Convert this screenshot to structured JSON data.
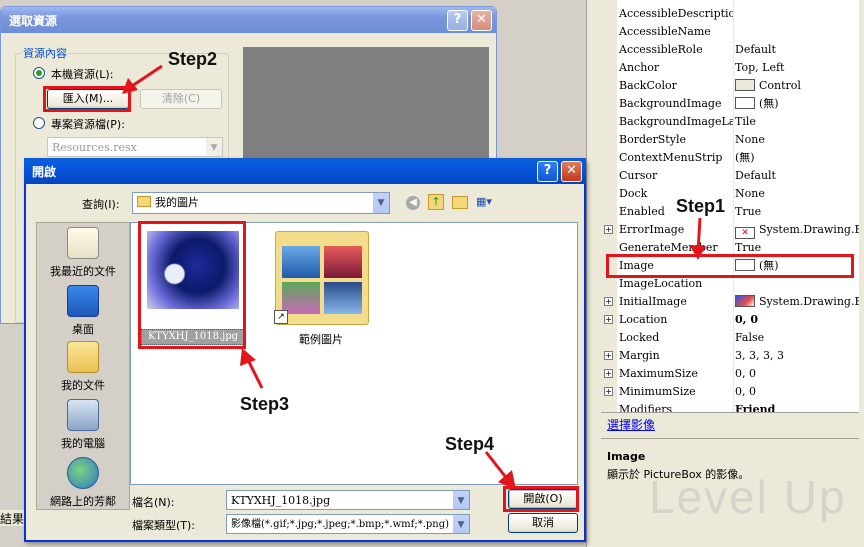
{
  "resource_dialog": {
    "title": "選取資源",
    "group_label": "資源內容",
    "local_radio": "本機資源(L):",
    "import_btn": "匯入(M)...",
    "clear_btn": "清除(C)",
    "project_radio": "專案資源檔(P):",
    "project_combo": "Resources.resx"
  },
  "open_dialog": {
    "title": "開啟",
    "lookin_label": "查詢(I):",
    "lookin_value": "我的圖片",
    "places": [
      "我最近的文件",
      "桌面",
      "我的文件",
      "我的電腦",
      "網路上的芳鄰"
    ],
    "files": [
      {
        "name": "KTYXHJ_1018.jpg"
      },
      {
        "name": "範例圖片"
      }
    ],
    "filename_label": "檔名(N):",
    "filename_value": "KTYXHJ_1018.jpg",
    "filetype_label": "檔案類型(T):",
    "filetype_value": "影像檔(*.gif;*.jpg;*.jpeg;*.bmp;*.wmf;*.png)",
    "open_btn": "開啟(O)",
    "cancel_btn": "取消"
  },
  "steps": [
    "Step1",
    "Step2",
    "Step3",
    "Step4"
  ],
  "properties": {
    "rows": [
      {
        "name": "AccessibleDescription",
        "value": "",
        "expand": false
      },
      {
        "name": "AccessibleName",
        "value": "",
        "expand": false
      },
      {
        "name": "AccessibleRole",
        "value": "Default",
        "expand": false
      },
      {
        "name": "Anchor",
        "value": "Top, Left",
        "expand": false
      },
      {
        "name": "BackColor",
        "value": "Control",
        "expand": false,
        "swatch": "#ece9d8"
      },
      {
        "name": "BackgroundImage",
        "value": "(無)",
        "expand": false,
        "swatch": "#ffffff"
      },
      {
        "name": "BackgroundImageLayout",
        "value": "Tile",
        "expand": false
      },
      {
        "name": "BorderStyle",
        "value": "None",
        "expand": false
      },
      {
        "name": "ContextMenuStrip",
        "value": "(無)",
        "expand": false
      },
      {
        "name": "Cursor",
        "value": "Default",
        "expand": false
      },
      {
        "name": "Dock",
        "value": "None",
        "expand": false
      },
      {
        "name": "Enabled",
        "value": "True",
        "expand": false
      },
      {
        "name": "ErrorImage",
        "value": "System.Drawing.Bitmap",
        "expand": true,
        "swatch": "err"
      },
      {
        "name": "GenerateMember",
        "value": "True",
        "expand": false
      },
      {
        "name": "Image",
        "value": "(無)",
        "expand": false,
        "swatch": "#ffffff"
      },
      {
        "name": "ImageLocation",
        "value": "",
        "expand": false
      },
      {
        "name": "InitialImage",
        "value": "System.Drawing.Bitmap",
        "expand": true,
        "swatch": "img"
      },
      {
        "name": "Location",
        "value": "0, 0",
        "expand": true,
        "bold": true
      },
      {
        "name": "Locked",
        "value": "False",
        "expand": false
      },
      {
        "name": "Margin",
        "value": "3, 3, 3, 3",
        "expand": true
      },
      {
        "name": "MaximumSize",
        "value": "0, 0",
        "expand": true
      },
      {
        "name": "MinimumSize",
        "value": "0, 0",
        "expand": true
      },
      {
        "name": "Modifiers",
        "value": "Friend",
        "expand": false,
        "bold": true
      }
    ],
    "link": "選擇影像",
    "desc_title": "Image",
    "desc_text": "顯示於 PictureBox 的影像。"
  },
  "status_text": "結果",
  "watermark": "Level Up",
  "colors": {
    "highlight": "#e3141b",
    "xp_blue": "#0855dd"
  }
}
